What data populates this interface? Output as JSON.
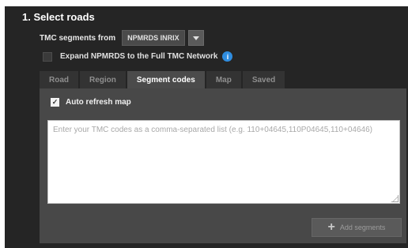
{
  "section": {
    "title": "1. Select roads"
  },
  "tmc": {
    "label": "TMC segments from",
    "selected": "NPMRDS INRIX"
  },
  "expand": {
    "label": "Expand NPMRDS to the Full TMC Network",
    "info_glyph": "i"
  },
  "tabs": [
    {
      "label": "Road",
      "active": false
    },
    {
      "label": "Region",
      "active": false
    },
    {
      "label": "Segment codes",
      "active": true
    },
    {
      "label": "Map",
      "active": false
    },
    {
      "label": "Saved",
      "active": false
    }
  ],
  "auto_refresh": {
    "label": "Auto refresh map",
    "checked": true
  },
  "codes_input": {
    "value": "",
    "placeholder": "Enter your TMC codes as a comma-separated list (e.g. 110+04645,110P04645,110+04646)"
  },
  "add_button": {
    "label": "Add segments"
  },
  "colors": {
    "panel": "#252525",
    "tab_active": "#4b4b4b",
    "info": "#2f8de0"
  }
}
